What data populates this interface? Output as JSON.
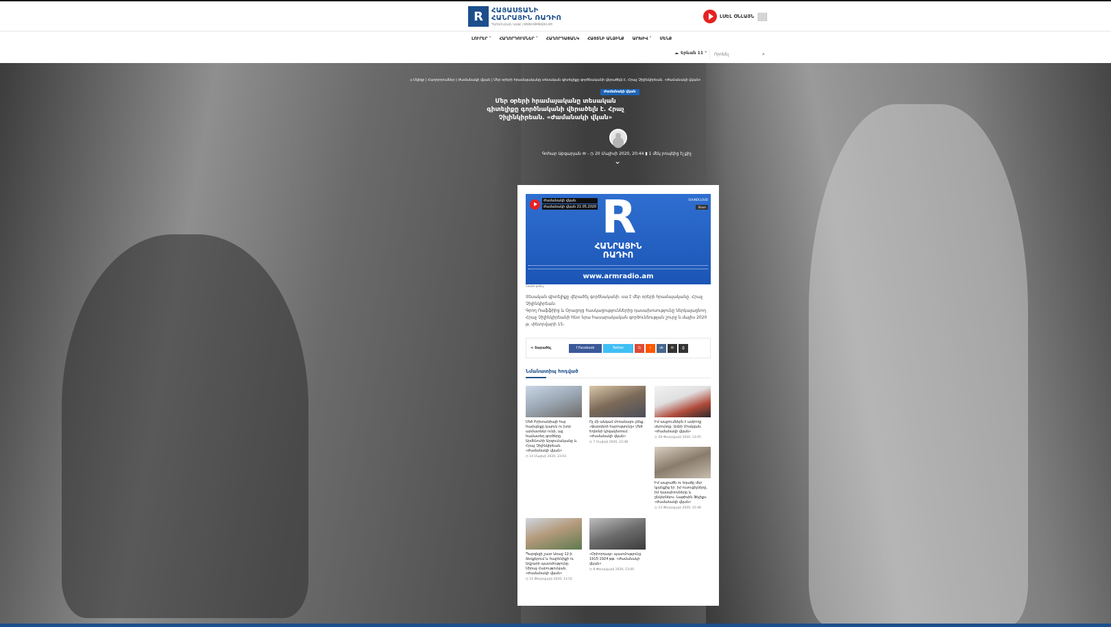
{
  "header": {
    "logo_mark": "R",
    "logo_line1": "ՀԱՅԱՍՏԱՆԻ",
    "logo_line2": "ՀԱՆՐԱՅԻՆ ՌԱԴԻՈ",
    "logo_sub": "ՊԱՇՏՈՆԱԿԱՆ ԿԱՅՔ | WWW.ARMRADIO.AM",
    "live_label": "ԼՍԵԼ ՕՆԼԱՅՆ",
    "wave": "|||||||"
  },
  "nav": {
    "items": [
      {
        "label": "ԼՈՒՐԵՐ ˅"
      },
      {
        "label": "ՀԱՂՈՐԴՈՒՄՆԵՐ ˅"
      },
      {
        "label": "ՀԱՂՈՐԴԱՑԱՆԿ"
      },
      {
        "label": "ՀԱՅՏՆԻ ԱՆՁԻՆՔ"
      },
      {
        "label": "ԱՐԽԻՎ ˅"
      },
      {
        "label": "ՄԵՆՔ"
      }
    ]
  },
  "subnav": {
    "weather": "Երևան 11 °",
    "search_placeholder": "Որոնել"
  },
  "post": {
    "breadcrumb": "⌂ Սկիզբ | Հաղորդումներ | Ժամանակի վկան | Մեր օրերի հրամայականը տեսական գիտելիքը գործնականի վերածելն է. Հրաչ Չիլինկիրեան. «Ժամանակի վկան»",
    "category": "Ժամանակի վկան",
    "title": "Մեր օրերի հրամայականը տեսական գիտելիքը գործնականի վերածելն է. Հրաչ Չիլինկիրեան. «Ժամանակի վկան»",
    "author": "Գոհար Աբգարյան",
    "date": "20 Մայիսի 2020, 20:44",
    "read_time": "1 մեկ րոպեից էլ քիչ"
  },
  "player": {
    "program": "Ժամանակի վկան",
    "episode": "Ժամանակի վկան 21.05.2020",
    "soundcloud": "SOUNDCLOUD",
    "share": "Share",
    "brand_line1": "ՀԱՆՐԱՅԻՆ",
    "brand_line2": "ՌԱԴԻՈ",
    "url": "www.armradio.am",
    "cookie": "Cookie policy"
  },
  "body": {
    "p1": "Տեսական գիտելիքը վերածել գործնականի. սա է մեր օրերի հրամայականը. Հրաչ Չիլինկիրեան։",
    "p2": "Գրող Ռաֆֆիից և Օրացոյց հասկացություններից դասախոսությունը ներկայացնող Հրաչ Չիլինկիրեանի հետ նրա հասարակական գործունեության շուրջ ն.մայիս 2020 թ. փետրվարի 15։"
  },
  "share": {
    "label": "Տարածել",
    "facebook": "f  Facebook",
    "twitter": "Twitter",
    "google": "G",
    "reddit": "r",
    "vk": "vk",
    "email": "✉",
    "print": "⎙"
  },
  "related": {
    "title": "Նմանատիպ հոդված",
    "items": [
      {
        "title": "Մեծ Բրիտանիայի հայ համայնքը կայուն ու խոր արմատներ ունի, այլ համատեղ գործերը. Արմենուհի Արզումանյանը և Հրաչ Չիլինկիրեան. «Ժամանակի վկան»",
        "date": "◷ 14 Մայիսի 2020, 23:03"
      },
      {
        "title": "Ոչ մի անգամ մոռանալու չենք. «Ջարդերի հարությունը» Մեծ Եղեռնի կիզակետում. «Ժամանակի վկան»",
        "date": "◷ 7 Մայիսի 2020, 23:48"
      },
      {
        "title": "Իմ ապրումներն է ամբողջ սերունդը. Ամբի Մոսկվան. «Ժամանակի վկան»",
        "date": "◷ 28 Փետրվարի 2020, 13:05"
      },
      {
        "title": "Իմ ապրածն ու եղածը մեր կյանքից էր. իմ ուսուցիչները, իմ դասախոսները և ընկերներս. Լաթիսին Ֆելիքս. «Ժամանակի վկան»",
        "date": "◷ 23 Փետրվարի 2020, 15:48"
      },
      {
        "title": "Պարզեցի շատ Առաջ 12-ի ձեռքերում և հայրենիքի ու Ավշարի պատմությունը. Սիրաչ Հարությունյան. «Ժամանակի վկան»",
        "date": "◷ 15 Փետրվարի 2020, 13:52"
      },
      {
        "title": "«Օրիորդաց» պատմությունը 1915-1924 թթ. «Ժամանակի վկան»",
        "date": "◷ 8 Փետրվարի 2020, 13:00"
      }
    ]
  }
}
